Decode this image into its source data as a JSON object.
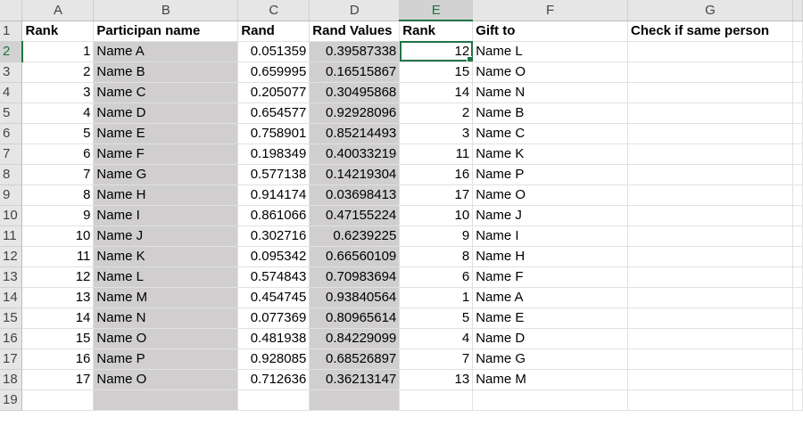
{
  "columns": [
    "A",
    "B",
    "C",
    "D",
    "E",
    "F",
    "G"
  ],
  "row_numbers": [
    "1",
    "2",
    "3",
    "4",
    "5",
    "6",
    "7",
    "8",
    "9",
    "10",
    "11",
    "12",
    "13",
    "14",
    "15",
    "16",
    "17",
    "18",
    "19"
  ],
  "headers": {
    "rank": "Rank",
    "participant": "Participan name",
    "rand": "Rand",
    "rand_values": "Rand Values",
    "rank2": "Rank",
    "gift_to": "Gift to",
    "check": "Check if same person"
  },
  "rows": [
    {
      "rank": "1",
      "name": "Name A",
      "rand": "0.051359",
      "rand_values": "0.39587338",
      "rank2": "12",
      "gift_to": "Name L"
    },
    {
      "rank": "2",
      "name": "Name B",
      "rand": "0.659995",
      "rand_values": "0.16515867",
      "rank2": "15",
      "gift_to": "Name O"
    },
    {
      "rank": "3",
      "name": "Name C",
      "rand": "0.205077",
      "rand_values": "0.30495868",
      "rank2": "14",
      "gift_to": "Name N"
    },
    {
      "rank": "4",
      "name": "Name D",
      "rand": "0.654577",
      "rand_values": "0.92928096",
      "rank2": "2",
      "gift_to": "Name B"
    },
    {
      "rank": "5",
      "name": "Name E",
      "rand": "0.758901",
      "rand_values": "0.85214493",
      "rank2": "3",
      "gift_to": "Name C"
    },
    {
      "rank": "6",
      "name": "Name F",
      "rand": "0.198349",
      "rand_values": "0.40033219",
      "rank2": "11",
      "gift_to": "Name K"
    },
    {
      "rank": "7",
      "name": "Name G",
      "rand": "0.577138",
      "rand_values": "0.14219304",
      "rank2": "16",
      "gift_to": "Name P"
    },
    {
      "rank": "8",
      "name": "Name H",
      "rand": "0.914174",
      "rand_values": "0.03698413",
      "rank2": "17",
      "gift_to": "Name O"
    },
    {
      "rank": "9",
      "name": "Name I",
      "rand": "0.861066",
      "rand_values": "0.47155224",
      "rank2": "10",
      "gift_to": "Name J"
    },
    {
      "rank": "10",
      "name": "Name J",
      "rand": "0.302716",
      "rand_values": "0.6239225",
      "rank2": "9",
      "gift_to": "Name I"
    },
    {
      "rank": "11",
      "name": "Name K",
      "rand": "0.095342",
      "rand_values": "0.66560109",
      "rank2": "8",
      "gift_to": "Name H"
    },
    {
      "rank": "12",
      "name": "Name L",
      "rand": "0.574843",
      "rand_values": "0.70983694",
      "rank2": "6",
      "gift_to": "Name F"
    },
    {
      "rank": "13",
      "name": "Name M",
      "rand": "0.454745",
      "rand_values": "0.93840564",
      "rank2": "1",
      "gift_to": "Name A"
    },
    {
      "rank": "14",
      "name": "Name N",
      "rand": "0.077369",
      "rand_values": "0.80965614",
      "rank2": "5",
      "gift_to": "Name E"
    },
    {
      "rank": "15",
      "name": "Name O",
      "rand": "0.481938",
      "rand_values": "0.84229099",
      "rank2": "4",
      "gift_to": "Name D"
    },
    {
      "rank": "16",
      "name": "Name P",
      "rand": "0.928085",
      "rand_values": "0.68526897",
      "rank2": "7",
      "gift_to": "Name G"
    },
    {
      "rank": "17",
      "name": "Name O",
      "rand": "0.712636",
      "rand_values": "0.36213147",
      "rank2": "13",
      "gift_to": "Name M"
    }
  ],
  "selected_column": "E",
  "selected_row": "2",
  "colors": {
    "accent": "#217346",
    "grey_fill": "#d0cece",
    "header_bg": "#e6e6e6"
  }
}
